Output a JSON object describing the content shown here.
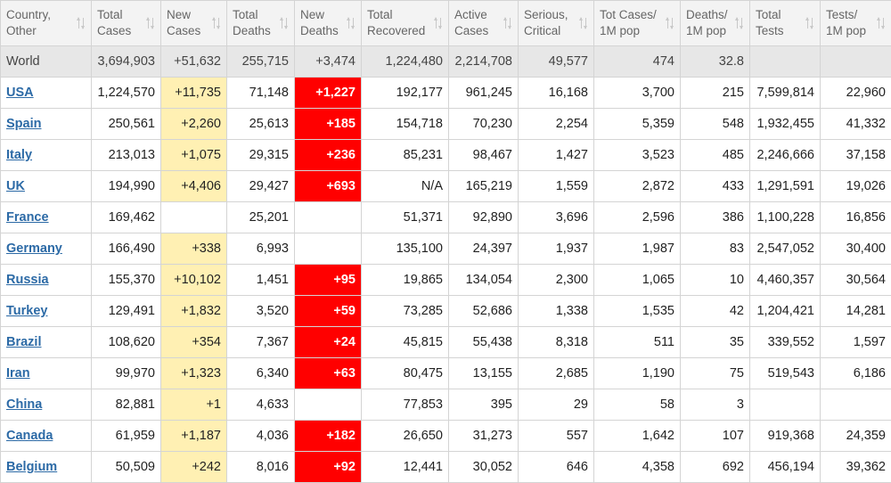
{
  "headers": [
    {
      "line1": "Country,",
      "line2": "Other"
    },
    {
      "line1": "Total",
      "line2": "Cases"
    },
    {
      "line1": "New",
      "line2": "Cases"
    },
    {
      "line1": "Total",
      "line2": "Deaths"
    },
    {
      "line1": "New",
      "line2": "Deaths"
    },
    {
      "line1": "Total",
      "line2": "Recovered"
    },
    {
      "line1": "Active",
      "line2": "Cases"
    },
    {
      "line1": "Serious,",
      "line2": "Critical"
    },
    {
      "line1": "Tot Cases/",
      "line2": "1M pop"
    },
    {
      "line1": "Deaths/",
      "line2": "1M pop"
    },
    {
      "line1": "Total",
      "line2": "Tests"
    },
    {
      "line1": "Tests/",
      "line2": "1M pop"
    }
  ],
  "world": {
    "country": "World",
    "total_cases": "3,694,903",
    "new_cases": "+51,632",
    "total_deaths": "255,715",
    "new_deaths": "+3,474",
    "total_recovered": "1,224,480",
    "active_cases": "2,214,708",
    "serious": "49,577",
    "cases_per_1m": "474",
    "deaths_per_1m": "32.8",
    "total_tests": "",
    "tests_per_1m": ""
  },
  "rows": [
    {
      "country": "USA",
      "total_cases": "1,224,570",
      "new_cases": "+11,735",
      "total_deaths": "71,148",
      "new_deaths": "+1,227",
      "total_recovered": "192,177",
      "active_cases": "961,245",
      "serious": "16,168",
      "cases_per_1m": "3,700",
      "deaths_per_1m": "215",
      "total_tests": "7,599,814",
      "tests_per_1m": "22,960"
    },
    {
      "country": "Spain",
      "total_cases": "250,561",
      "new_cases": "+2,260",
      "total_deaths": "25,613",
      "new_deaths": "+185",
      "total_recovered": "154,718",
      "active_cases": "70,230",
      "serious": "2,254",
      "cases_per_1m": "5,359",
      "deaths_per_1m": "548",
      "total_tests": "1,932,455",
      "tests_per_1m": "41,332"
    },
    {
      "country": "Italy",
      "total_cases": "213,013",
      "new_cases": "+1,075",
      "total_deaths": "29,315",
      "new_deaths": "+236",
      "total_recovered": "85,231",
      "active_cases": "98,467",
      "serious": "1,427",
      "cases_per_1m": "3,523",
      "deaths_per_1m": "485",
      "total_tests": "2,246,666",
      "tests_per_1m": "37,158"
    },
    {
      "country": "UK",
      "total_cases": "194,990",
      "new_cases": "+4,406",
      "total_deaths": "29,427",
      "new_deaths": "+693",
      "total_recovered": "N/A",
      "active_cases": "165,219",
      "serious": "1,559",
      "cases_per_1m": "2,872",
      "deaths_per_1m": "433",
      "total_tests": "1,291,591",
      "tests_per_1m": "19,026"
    },
    {
      "country": "France",
      "total_cases": "169,462",
      "new_cases": "",
      "total_deaths": "25,201",
      "new_deaths": "",
      "total_recovered": "51,371",
      "active_cases": "92,890",
      "serious": "3,696",
      "cases_per_1m": "2,596",
      "deaths_per_1m": "386",
      "total_tests": "1,100,228",
      "tests_per_1m": "16,856"
    },
    {
      "country": "Germany",
      "total_cases": "166,490",
      "new_cases": "+338",
      "total_deaths": "6,993",
      "new_deaths": "",
      "total_recovered": "135,100",
      "active_cases": "24,397",
      "serious": "1,937",
      "cases_per_1m": "1,987",
      "deaths_per_1m": "83",
      "total_tests": "2,547,052",
      "tests_per_1m": "30,400"
    },
    {
      "country": "Russia",
      "total_cases": "155,370",
      "new_cases": "+10,102",
      "total_deaths": "1,451",
      "new_deaths": "+95",
      "total_recovered": "19,865",
      "active_cases": "134,054",
      "serious": "2,300",
      "cases_per_1m": "1,065",
      "deaths_per_1m": "10",
      "total_tests": "4,460,357",
      "tests_per_1m": "30,564"
    },
    {
      "country": "Turkey",
      "total_cases": "129,491",
      "new_cases": "+1,832",
      "total_deaths": "3,520",
      "new_deaths": "+59",
      "total_recovered": "73,285",
      "active_cases": "52,686",
      "serious": "1,338",
      "cases_per_1m": "1,535",
      "deaths_per_1m": "42",
      "total_tests": "1,204,421",
      "tests_per_1m": "14,281"
    },
    {
      "country": "Brazil",
      "total_cases": "108,620",
      "new_cases": "+354",
      "total_deaths": "7,367",
      "new_deaths": "+24",
      "total_recovered": "45,815",
      "active_cases": "55,438",
      "serious": "8,318",
      "cases_per_1m": "511",
      "deaths_per_1m": "35",
      "total_tests": "339,552",
      "tests_per_1m": "1,597"
    },
    {
      "country": "Iran",
      "total_cases": "99,970",
      "new_cases": "+1,323",
      "total_deaths": "6,340",
      "new_deaths": "+63",
      "total_recovered": "80,475",
      "active_cases": "13,155",
      "serious": "2,685",
      "cases_per_1m": "1,190",
      "deaths_per_1m": "75",
      "total_tests": "519,543",
      "tests_per_1m": "6,186"
    },
    {
      "country": "China",
      "total_cases": "82,881",
      "new_cases": "+1",
      "total_deaths": "4,633",
      "new_deaths": "",
      "total_recovered": "77,853",
      "active_cases": "395",
      "serious": "29",
      "cases_per_1m": "58",
      "deaths_per_1m": "3",
      "total_tests": "",
      "tests_per_1m": ""
    },
    {
      "country": "Canada",
      "total_cases": "61,959",
      "new_cases": "+1,187",
      "total_deaths": "4,036",
      "new_deaths": "+182",
      "total_recovered": "26,650",
      "active_cases": "31,273",
      "serious": "557",
      "cases_per_1m": "1,642",
      "deaths_per_1m": "107",
      "total_tests": "919,368",
      "tests_per_1m": "24,359"
    },
    {
      "country": "Belgium",
      "total_cases": "50,509",
      "new_cases": "+242",
      "total_deaths": "8,016",
      "new_deaths": "+92",
      "total_recovered": "12,441",
      "active_cases": "30,052",
      "serious": "646",
      "cases_per_1m": "4,358",
      "deaths_per_1m": "692",
      "total_tests": "456,194",
      "tests_per_1m": "39,362"
    }
  ],
  "colors": {
    "new_cases_bg": "#fff0b3",
    "new_deaths_bg": "#ff0000",
    "link": "#2c6aa6",
    "header_bg": "#f3f3f3",
    "world_bg": "#e7e7e7"
  }
}
